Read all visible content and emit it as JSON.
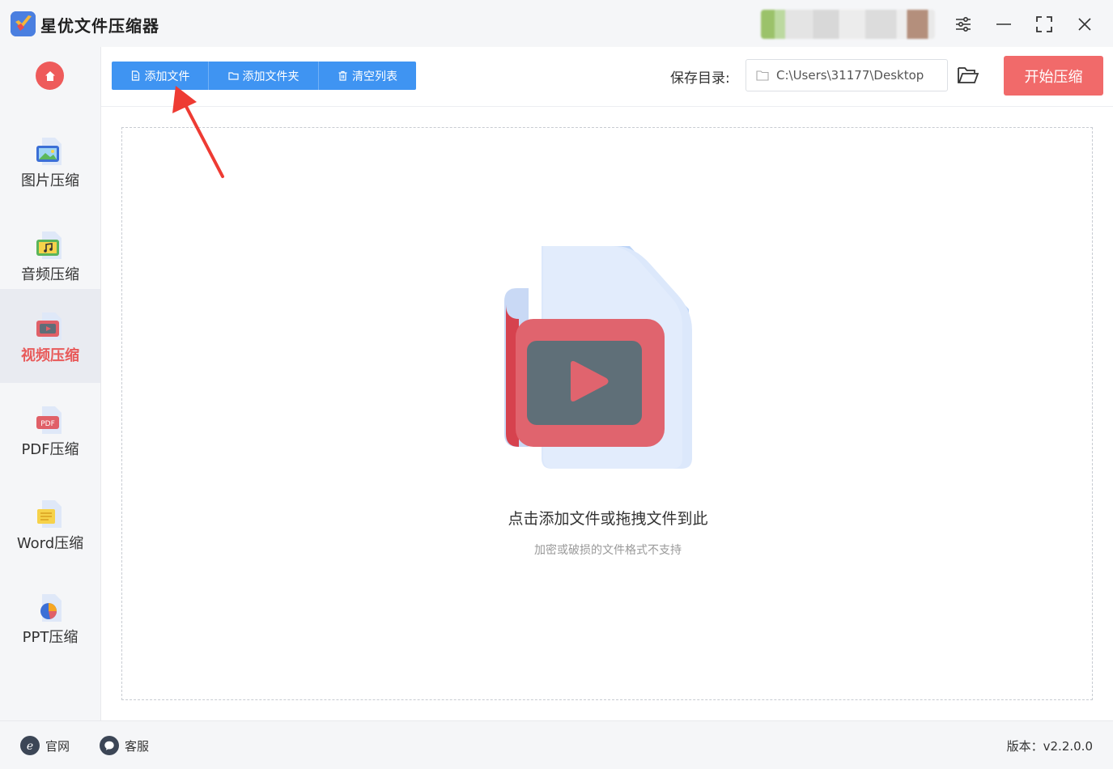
{
  "app": {
    "title": "星优文件压缩器"
  },
  "sidebar": {
    "items": [
      {
        "label": "图片压缩",
        "icon": "image-file-icon"
      },
      {
        "label": "音频压缩",
        "icon": "audio-file-icon"
      },
      {
        "label": "视频压缩",
        "icon": "video-file-icon",
        "active": true
      },
      {
        "label": "PDF压缩",
        "icon": "pdf-file-icon"
      },
      {
        "label": "Word压缩",
        "icon": "word-file-icon"
      },
      {
        "label": "PPT压缩",
        "icon": "ppt-file-icon"
      }
    ]
  },
  "toolbar": {
    "add_file": "添加文件",
    "add_folder": "添加文件夹",
    "clear_list": "清空列表",
    "save_dir_label": "保存目录:",
    "save_dir_value": "C:\\Users\\31177\\Desktop",
    "start_button": "开始压缩"
  },
  "dropzone": {
    "main_text": "点击添加文件或拖拽文件到此",
    "sub_text": "加密或破损的文件格式不支持"
  },
  "footer": {
    "website": "官网",
    "support": "客服",
    "version": "版本：v2.2.0.0"
  },
  "colors": {
    "accent_blue": "#3f94f2",
    "accent_red": "#f16a6a",
    "active_red": "#e85a5a"
  }
}
